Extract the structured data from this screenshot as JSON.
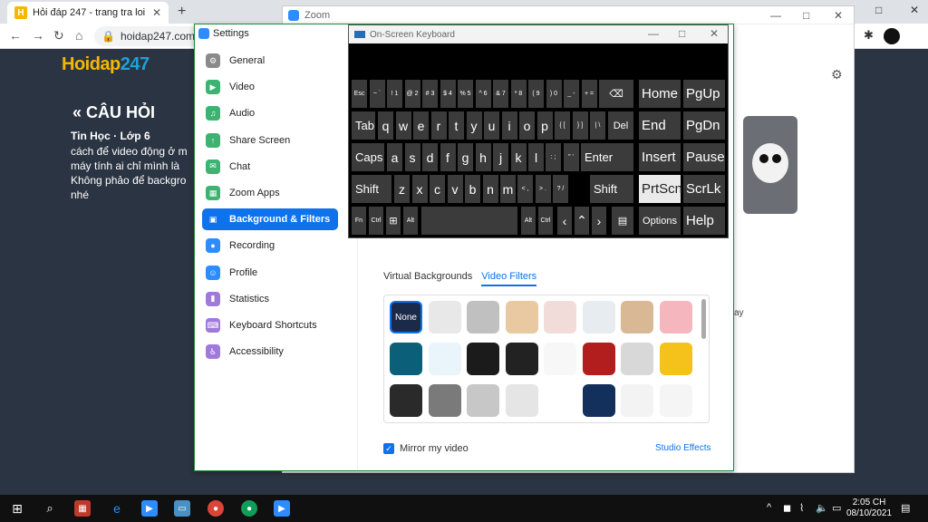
{
  "browser": {
    "tab_title": "Hỏi đáp 247 - trang tra loi",
    "tab_close": "✕",
    "new_tab": "+",
    "url": "hoidap247.com/a",
    "min": "—",
    "max": "□",
    "close": "✕"
  },
  "page": {
    "logo_a": "Hoidap",
    "logo_b": "247",
    "heading": "« CÂU HỎI",
    "subject": "Tin Học · Lớp 6",
    "question": "cách để video động ở m máy tính ai chỉ mình là Không phảo để backgro nhé"
  },
  "zoom_main": {
    "title": "Zoom",
    "fragment": "ay"
  },
  "settings": {
    "title": "Settings",
    "items": [
      {
        "label": "General",
        "icon": "gear-icon",
        "color": "#8a8a8a",
        "glyph": "⚙"
      },
      {
        "label": "Video",
        "icon": "video-icon",
        "color": "#3cb371",
        "glyph": "▶"
      },
      {
        "label": "Audio",
        "icon": "headphones-icon",
        "color": "#3cb371",
        "glyph": "♫"
      },
      {
        "label": "Share Screen",
        "icon": "share-icon",
        "color": "#3cb371",
        "glyph": "↑"
      },
      {
        "label": "Chat",
        "icon": "chat-icon",
        "color": "#3cb371",
        "glyph": "✉"
      },
      {
        "label": "Zoom Apps",
        "icon": "apps-icon",
        "color": "#3cb371",
        "glyph": "▦"
      },
      {
        "label": "Background & Filters",
        "icon": "background-icon",
        "color": "#ffffff",
        "glyph": "▣"
      },
      {
        "label": "Recording",
        "icon": "record-icon",
        "color": "#2d8cff",
        "glyph": "●"
      },
      {
        "label": "Profile",
        "icon": "profile-icon",
        "color": "#2d8cff",
        "glyph": "☺"
      },
      {
        "label": "Statistics",
        "icon": "stats-icon",
        "color": "#a07adb",
        "glyph": "▮"
      },
      {
        "label": "Keyboard Shortcuts",
        "icon": "keyboard-icon",
        "color": "#a07adb",
        "glyph": "⌨"
      },
      {
        "label": "Accessibility",
        "icon": "accessibility-icon",
        "color": "#a07adb",
        "glyph": "♿"
      }
    ],
    "active_index": 6,
    "tab_virtual": "Virtual Backgrounds",
    "tab_filters": "Video Filters",
    "filter_none": "None",
    "mirror_label": "Mirror my video",
    "mirror_check": "✓",
    "studio_effects": "Studio Effects"
  },
  "filters_row1": [
    "#e8e8e8",
    "#c0c0c0",
    "#e9c9a1",
    "#f1dcd9",
    "#e6ecef",
    "#d9b895",
    "#f6b6bd"
  ],
  "filters_row2": [
    "#0b5f78",
    "#eaf4fb",
    "#1b1b1b",
    "#222222",
    "#f7f7f7",
    "#b21d1d",
    "#d8d8d8",
    "#f4c21b"
  ],
  "filters_row3": [
    "#2a2a2a",
    "#7a7a7a",
    "#c7c7c7",
    "#e5e5e5",
    "#ffffff",
    "#13305c",
    "#f3f3f3",
    "#f5f5f5"
  ],
  "osk": {
    "title": "On-Screen Keyboard",
    "min": "—",
    "max": "□",
    "close": "✕",
    "row1": [
      "Esc",
      "~ `",
      "! 1",
      "@ 2",
      "# 3",
      "$ 4",
      "% 5",
      "^ 6",
      "& 7",
      "* 8",
      "( 9",
      ") 0",
      "_ -",
      "+ ="
    ],
    "row2": [
      "Tab",
      "q",
      "w",
      "e",
      "r",
      "t",
      "y",
      "u",
      "i",
      "o",
      "p",
      "{ [",
      "} ]",
      "| \\",
      "Del"
    ],
    "row3": [
      "Caps",
      "a",
      "s",
      "d",
      "f",
      "g",
      "h",
      "j",
      "k",
      "l",
      ": ;",
      "\" '",
      "Enter"
    ],
    "row4": [
      "Shift",
      "z",
      "x",
      "c",
      "v",
      "b",
      "n",
      "m",
      "< ,",
      "> .",
      "? /",
      "Shift"
    ],
    "row5": [
      "Fn",
      "Ctrl",
      "⊞",
      "Alt",
      "",
      "Alt",
      "Ctrl",
      "‹",
      "⌃",
      "›",
      "▤"
    ],
    "backspace": "⌫",
    "nav": [
      "Home",
      "PgUp",
      "End",
      "PgDn",
      "Insert",
      "Pause",
      "PrtScn",
      "ScrLk",
      "Options",
      "Help"
    ]
  },
  "taskbar": {
    "time": "2:05 CH",
    "date": "08/10/2021",
    "tray": "^"
  }
}
